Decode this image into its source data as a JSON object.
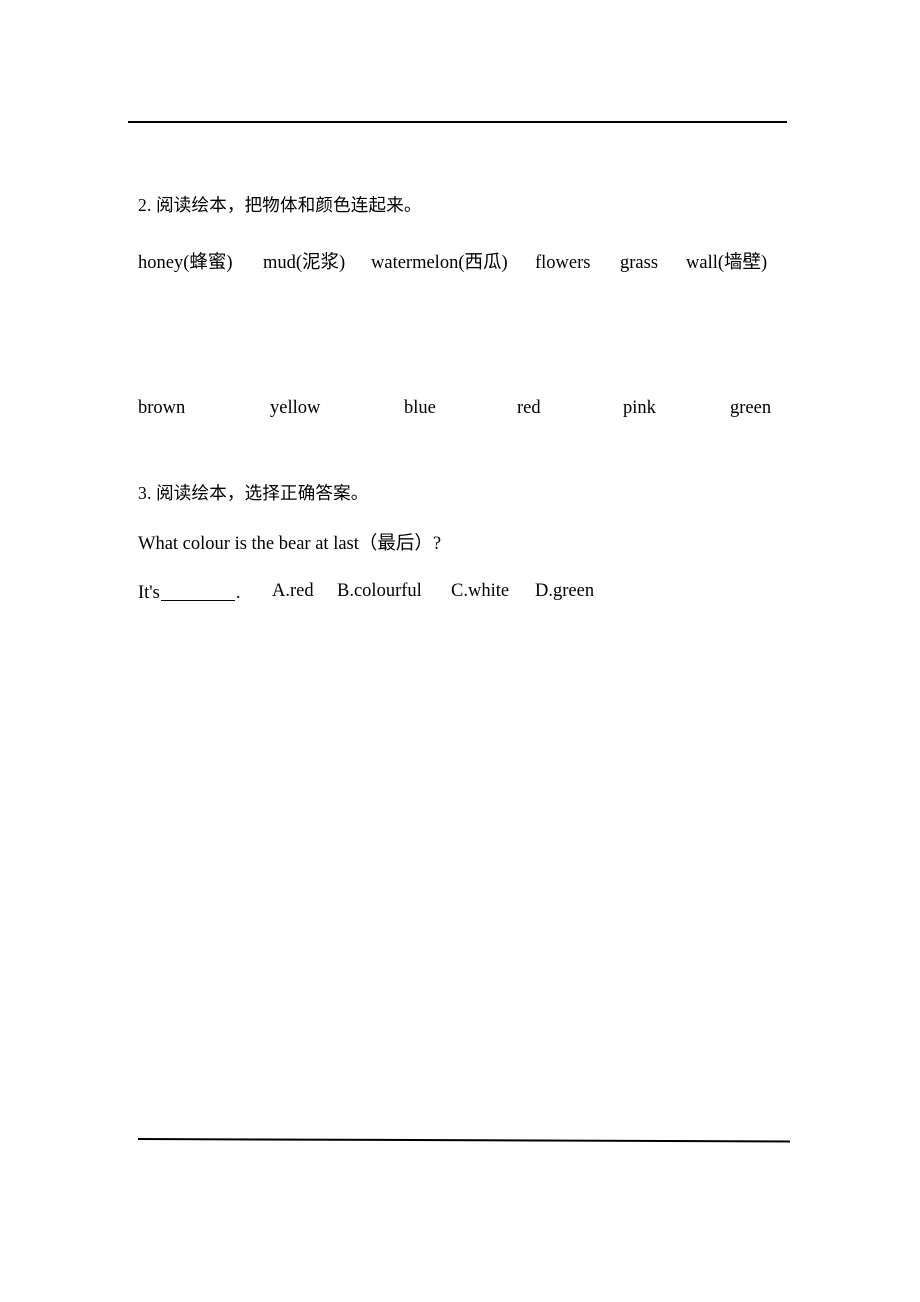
{
  "document": {
    "type": "worksheet-page",
    "background_color": "#ffffff",
    "text_color": "#000000"
  },
  "rules": {
    "top_label": "horizontal-rule-top",
    "bottom_label": "horizontal-rule-bottom"
  },
  "exercises": [
    {
      "number": "2.",
      "heading": "2. 阅读绘本，把物体和颜色连起来。",
      "objects_row": [
        "honey(蜂蜜)",
        "mud(泥浆)",
        "watermelon(西瓜)",
        "flowers",
        "grass",
        "wall(墙壁)"
      ],
      "colours_row": [
        "brown",
        "yellow",
        "blue",
        "red",
        "pink",
        "green"
      ]
    },
    {
      "number": "3.",
      "heading": "3. 阅读绘本，选择正确答案。",
      "question": "What colour is the bear at last（最后）?",
      "answer_stem": "It's",
      "answer_period": ".",
      "options": [
        "A.red",
        "B.colourful",
        "C.white",
        "D.green"
      ]
    }
  ]
}
